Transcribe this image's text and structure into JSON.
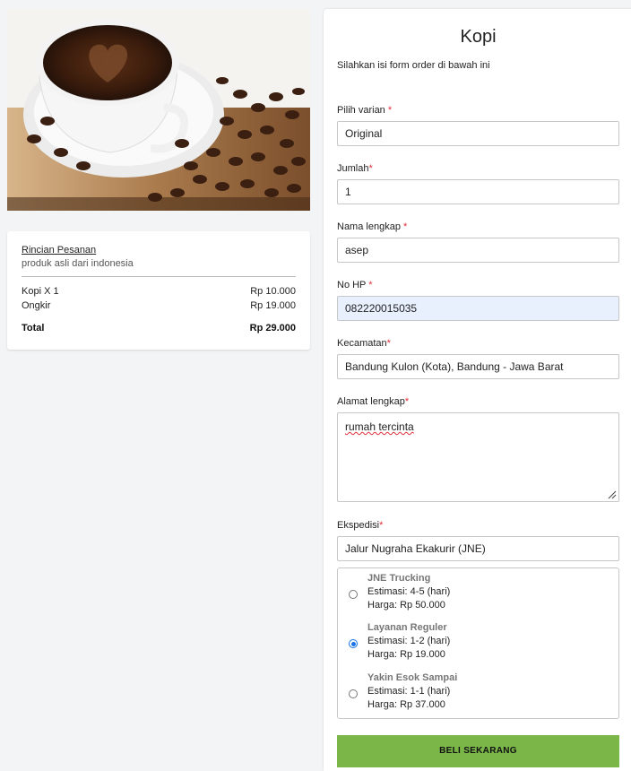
{
  "product": {
    "image_alt": "coffee cup with beans"
  },
  "summary": {
    "title": "Rincian Pesanan",
    "subtitle": "produk asli dari indonesia",
    "rows": [
      {
        "label": "Kopi X 1",
        "value": "Rp 10.000"
      },
      {
        "label": "Ongkir",
        "value": "Rp 19.000"
      }
    ],
    "total_label": "Total",
    "total_value": "Rp 29.000"
  },
  "form": {
    "title": "Kopi",
    "intro": "Silahkan isi form order di bawah ini",
    "required_mark": "*",
    "fields": {
      "varian": {
        "label": "Pilih varian ",
        "value": "Original"
      },
      "jumlah": {
        "label": "Jumlah",
        "value": "1"
      },
      "nama": {
        "label": "Nama lengkap ",
        "value": "asep"
      },
      "hp": {
        "label": "No HP ",
        "value": "082220015035"
      },
      "kecamatan": {
        "label": "Kecamatan",
        "value": "Bandung Kulon (Kota), Bandung - Jawa Barat"
      },
      "alamat": {
        "label": "Alamat lengkap",
        "value": "rumah tercinta"
      },
      "ekspedisi": {
        "label": "Ekspedisi",
        "value": "Jalur Nugraha Ekakurir (JNE)"
      }
    },
    "shipping_options": [
      {
        "name": "JNE Trucking",
        "estimate": "Estimasi: 4-5 (hari)",
        "price": "Harga: Rp 50.000",
        "checked": false
      },
      {
        "name": "Layanan Reguler",
        "estimate": "Estimasi: 1-2 (hari)",
        "price": "Harga: Rp 19.000",
        "checked": true
      },
      {
        "name": "Yakin Esok Sampai",
        "estimate": "Estimasi: 1-1 (hari)",
        "price": "Harga: Rp 37.000",
        "checked": false
      }
    ],
    "buy_label": "BELI SEKARANG"
  },
  "colors": {
    "accent_button": "#7ab648",
    "required": "#e0303b",
    "radio_checked": "#1a73e8"
  }
}
